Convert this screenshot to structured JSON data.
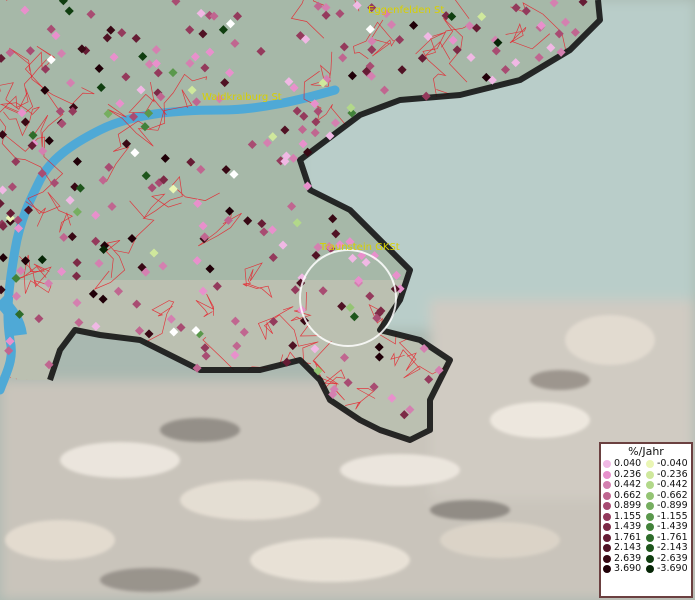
{
  "map": {
    "places": [
      {
        "name": "Eggenfelden St",
        "lon": 0.415,
        "lat": 0.055
      },
      {
        "name": "Waldkraiburg St",
        "lon": 0.175,
        "lat": 0.2
      },
      {
        "name": "Traunstein GKSt",
        "lon": 0.345,
        "lat": 0.45
      }
    ],
    "colors": {
      "land": "#a9b9aa",
      "water": "#4fa9d6",
      "border": "#151515",
      "districts": "#e8202a",
      "mountain": "#d9d1c6",
      "neighbor": "#b9cdc9",
      "marker_ring": "#ffffff"
    }
  },
  "legend": {
    "title": "%/Jahr",
    "positive": [
      {
        "label": "0.040",
        "color": "#f0b8e4"
      },
      {
        "label": "0.236",
        "color": "#e890cc"
      },
      {
        "label": "0.442",
        "color": "#d480b0"
      },
      {
        "label": "0.662",
        "color": "#c06690"
      },
      {
        "label": "0.899",
        "color": "#a84c72"
      },
      {
        "label": "1.155",
        "color": "#943a5c"
      },
      {
        "label": "1.439",
        "color": "#7c2a46"
      },
      {
        "label": "1.761",
        "color": "#661c34"
      },
      {
        "label": "2.143",
        "color": "#501224"
      },
      {
        "label": "2.639",
        "color": "#380814"
      },
      {
        "label": "3.690",
        "color": "#200008"
      }
    ],
    "negative": [
      {
        "label": "-0.040",
        "color": "#eaf6b4"
      },
      {
        "label": "-0.236",
        "color": "#cfe89c"
      },
      {
        "label": "-0.442",
        "color": "#b2d88a"
      },
      {
        "label": "-0.662",
        "color": "#94c474"
      },
      {
        "label": "-0.899",
        "color": "#76ae60"
      },
      {
        "label": "-1.155",
        "color": "#5a984c"
      },
      {
        "label": "-1.439",
        "color": "#42823a"
      },
      {
        "label": "-1.761",
        "color": "#2e6c2a"
      },
      {
        "label": "-2.143",
        "color": "#1e561c"
      },
      {
        "label": "-2.639",
        "color": "#103e10"
      },
      {
        "label": "-3.690",
        "color": "#062606"
      }
    ]
  }
}
